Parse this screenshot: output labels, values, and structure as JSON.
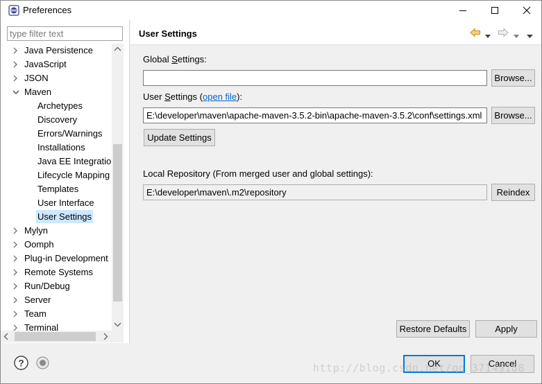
{
  "window": {
    "title": "Preferences"
  },
  "filter": {
    "placeholder": "type filter text"
  },
  "tree": {
    "items": [
      {
        "label": "Java Persistence",
        "level": 0,
        "state": "collapsed"
      },
      {
        "label": "JavaScript",
        "level": 0,
        "state": "collapsed"
      },
      {
        "label": "JSON",
        "level": 0,
        "state": "collapsed"
      },
      {
        "label": "Maven",
        "level": 0,
        "state": "expanded"
      },
      {
        "label": "Archetypes",
        "level": 1,
        "state": "leaf"
      },
      {
        "label": "Discovery",
        "level": 1,
        "state": "leaf"
      },
      {
        "label": "Errors/Warnings",
        "level": 1,
        "state": "leaf"
      },
      {
        "label": "Installations",
        "level": 1,
        "state": "leaf"
      },
      {
        "label": "Java EE Integration",
        "level": 1,
        "state": "leaf"
      },
      {
        "label": "Lifecycle Mapping",
        "level": 1,
        "state": "leaf"
      },
      {
        "label": "Templates",
        "level": 1,
        "state": "leaf"
      },
      {
        "label": "User Interface",
        "level": 1,
        "state": "leaf"
      },
      {
        "label": "User Settings",
        "level": 1,
        "state": "selected"
      },
      {
        "label": "Mylyn",
        "level": 0,
        "state": "collapsed"
      },
      {
        "label": "Oomph",
        "level": 0,
        "state": "collapsed"
      },
      {
        "label": "Plug-in Development",
        "level": 0,
        "state": "collapsed"
      },
      {
        "label": "Remote Systems",
        "level": 0,
        "state": "collapsed"
      },
      {
        "label": "Run/Debug",
        "level": 0,
        "state": "collapsed"
      },
      {
        "label": "Server",
        "level": 0,
        "state": "collapsed"
      },
      {
        "label": "Team",
        "level": 0,
        "state": "collapsed"
      },
      {
        "label": "Terminal",
        "level": 0,
        "state": "collapsed"
      }
    ]
  },
  "page": {
    "title": "User Settings",
    "global_settings_label_pre": "Global ",
    "global_settings_label_mnemonic": "S",
    "global_settings_label_post": "ettings:",
    "global_settings_value": "",
    "user_settings_label_pre": "User ",
    "user_settings_label_mnemonic": "S",
    "user_settings_label_post": "ettings (",
    "open_file_link": "open file",
    "user_settings_label_end": "):",
    "user_settings_value": "E:\\developer\\maven\\apache-maven-3.5.2-bin\\apache-maven-3.5.2\\conf\\settings.xml",
    "browse_label": "Browse...",
    "update_settings_label": "Update Settings",
    "local_repo_label": "Local Repository (From merged user and global settings):",
    "local_repo_value": "E:\\developer\\maven\\.m2\\repository",
    "reindex_label": "Reindex",
    "restore_defaults_label": "Restore Defaults",
    "apply_label": "Apply"
  },
  "footer": {
    "ok_label": "OK",
    "cancel_label": "Cancel",
    "watermark": "http://blog.csdn.net/qq_37149188"
  },
  "colors": {
    "selection": "#cce8ff",
    "default_button_border": "#0078d7",
    "link": "#0066cc",
    "nav_arrow": "#e8a317"
  },
  "icons": [
    "eclipse-app-icon",
    "minimize-icon",
    "maximize-icon",
    "close-icon",
    "back-arrow-icon",
    "forward-arrow-icon",
    "dropdown-icon",
    "menu-icon",
    "help-icon",
    "record-icon",
    "chevron-right-icon",
    "chevron-down-icon"
  ]
}
